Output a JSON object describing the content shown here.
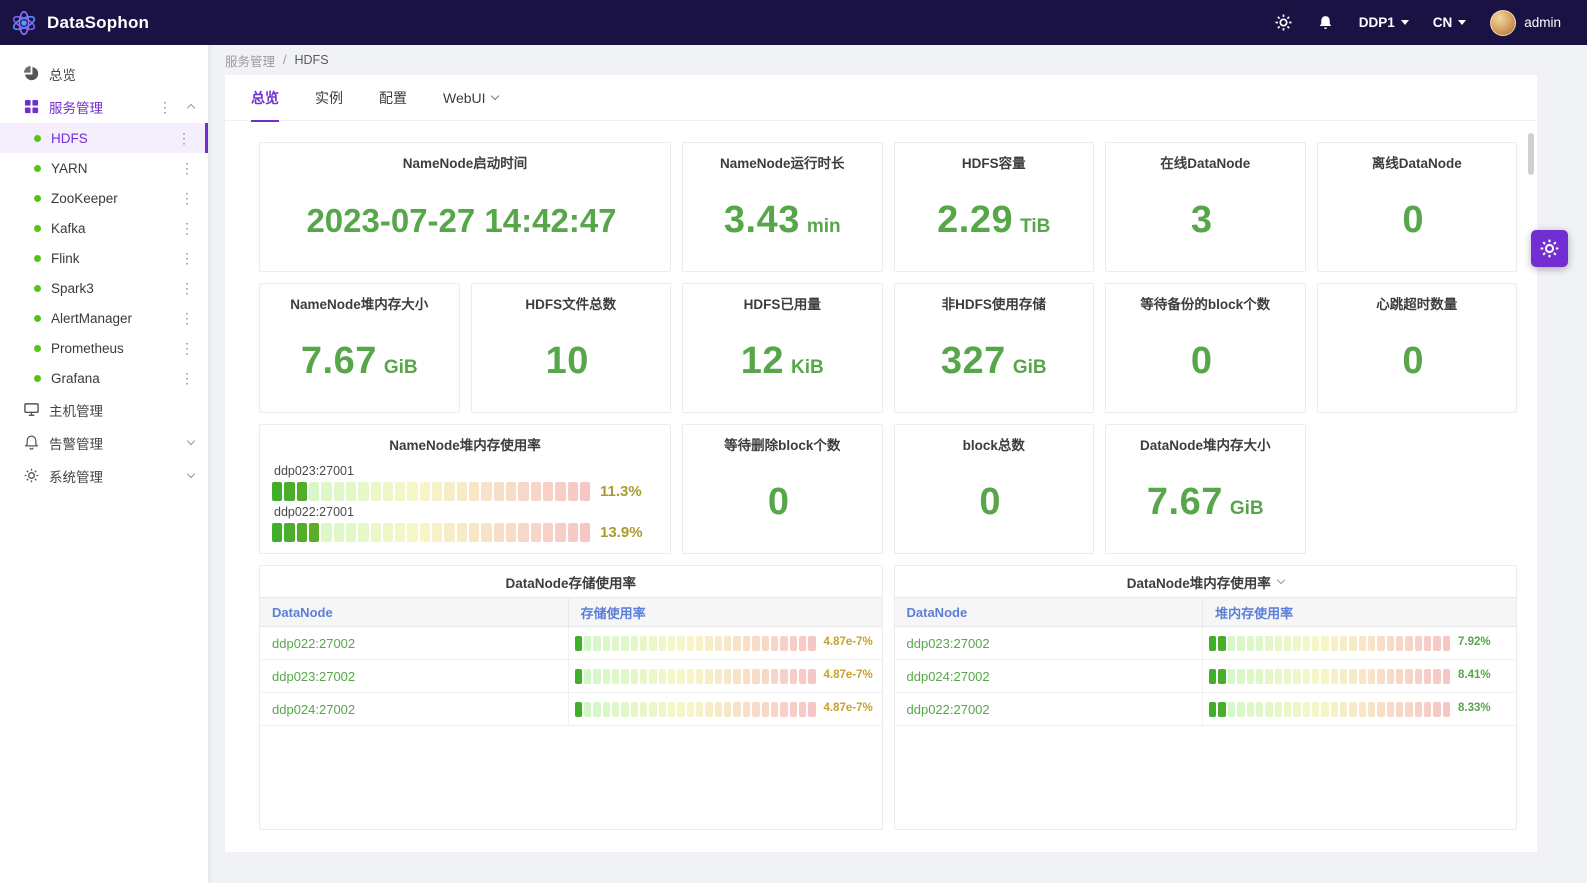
{
  "colors": {
    "topbar_bg": "#191243",
    "accent": "#722ed1",
    "value_green": "#57a64a",
    "percent_olive": "#ab9a2f",
    "percent_orange": "#cda127",
    "table_link": "#5b7fd9",
    "status_dot_green": "#52c41a"
  },
  "icons": {
    "kebab": "⋮"
  },
  "topbar": {
    "brand": "DataSophon",
    "cluster": "DDP1",
    "language": "CN",
    "user": "admin"
  },
  "sidebar": {
    "overview": "总览",
    "service_mgmt": "服务管理",
    "services": [
      {
        "name": "HDFS",
        "active": true
      },
      {
        "name": "YARN"
      },
      {
        "name": "ZooKeeper"
      },
      {
        "name": "Kafka"
      },
      {
        "name": "Flink"
      },
      {
        "name": "Spark3"
      },
      {
        "name": "AlertManager"
      },
      {
        "name": "Prometheus"
      },
      {
        "name": "Grafana"
      }
    ],
    "host_mgmt": "主机管理",
    "alert_mgmt": "告警管理",
    "system_mgmt": "系统管理"
  },
  "breadcrumb": {
    "items": [
      "服务管理",
      "HDFS"
    ],
    "separator": "/"
  },
  "tabs": [
    {
      "label": "总览"
    },
    {
      "label": "实例"
    },
    {
      "label": "配置"
    },
    {
      "label": "WebUI"
    }
  ],
  "stat_cards": [
    {
      "title": "NameNode启动时间",
      "value": "2023-07-27 14:42:47",
      "unit": ""
    },
    {
      "title": "NameNode运行时长",
      "value": "3.43",
      "unit": "min"
    },
    {
      "title": "HDFS容量",
      "value": "2.29",
      "unit": "TiB"
    },
    {
      "title": "在线DataNode",
      "value": "3",
      "unit": ""
    },
    {
      "title": "离线DataNode",
      "value": "0",
      "unit": ""
    },
    {
      "title": "NameNode堆内存大小",
      "value": "7.67",
      "unit": "GiB"
    },
    {
      "title": "HDFS文件总数",
      "value": "10",
      "unit": ""
    },
    {
      "title": "HDFS已用量",
      "value": "12",
      "unit": "KiB"
    },
    {
      "title": "非HDFS使用存储",
      "value": "327",
      "unit": "GiB"
    },
    {
      "title": "等待备份的block个数",
      "value": "0",
      "unit": ""
    },
    {
      "title": "心跳超时数量",
      "value": "0",
      "unit": ""
    },
    {
      "title": "等待删除block个数",
      "value": "0",
      "unit": ""
    },
    {
      "title": "block总数",
      "value": "0",
      "unit": ""
    },
    {
      "title": "DataNode堆内存大小",
      "value": "7.67",
      "unit": "GiB"
    }
  ],
  "heap_usage_card": {
    "title": "NameNode堆内存使用率",
    "rows": [
      {
        "label": "ddp023:27001",
        "percent": 11.3,
        "percent_text": "11.3%"
      },
      {
        "label": "ddp022:27001",
        "percent": 13.9,
        "percent_text": "13.9%"
      }
    ]
  },
  "tables": [
    {
      "title": "DataNode存储使用率",
      "columns": [
        "DataNode",
        "存储使用率"
      ],
      "rows": [
        {
          "node": "ddp022:27002",
          "percent": 4.87e-07,
          "percent_text": "4.87e-7%"
        },
        {
          "node": "ddp023:27002",
          "percent": 4.87e-07,
          "percent_text": "4.87e-7%"
        },
        {
          "node": "ddp024:27002",
          "percent": 4.87e-07,
          "percent_text": "4.87e-7%"
        }
      ]
    },
    {
      "title": "DataNode堆内存使用率",
      "columns": [
        "DataNode",
        "堆内存使用率"
      ],
      "rows": [
        {
          "node": "ddp023:27002",
          "percent": 7.92,
          "percent_text": "7.92%"
        },
        {
          "node": "ddp024:27002",
          "percent": 8.41,
          "percent_text": "8.41%"
        },
        {
          "node": "ddp022:27002",
          "percent": 8.33,
          "percent_text": "8.33%"
        }
      ]
    }
  ]
}
